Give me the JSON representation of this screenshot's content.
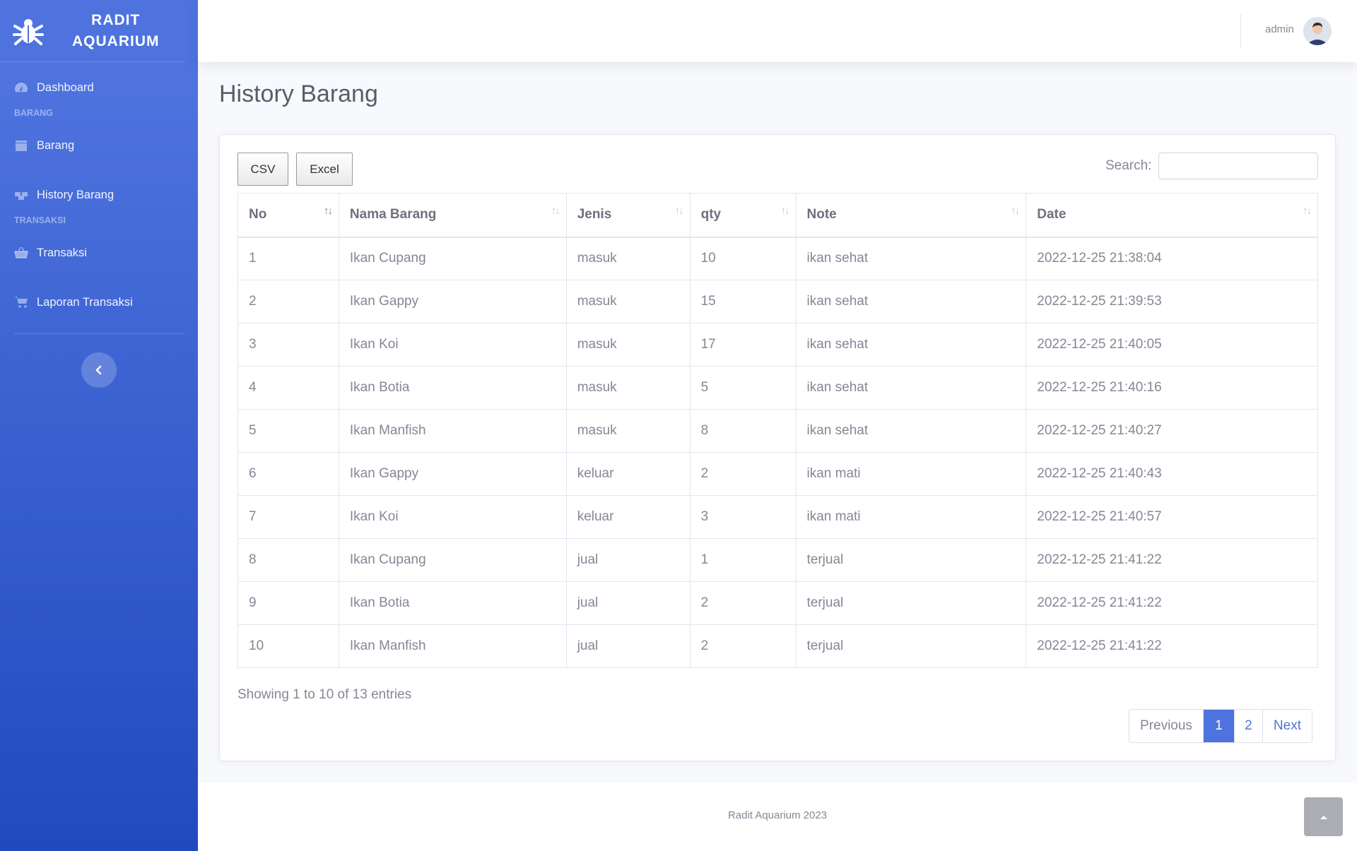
{
  "brand": {
    "line1": "RADIT",
    "line2": "AQUARIUM"
  },
  "sidebar": {
    "dashboard": "Dashboard",
    "heading_barang": "BARANG",
    "barang": "Barang",
    "history_barang": "History Barang",
    "heading_transaksi": "TRANSAKSI",
    "transaksi": "Transaksi",
    "laporan_transaksi": "Laporan Transaksi"
  },
  "topbar": {
    "user_name": "admin"
  },
  "page": {
    "title": "History Barang"
  },
  "toolbar": {
    "csv": "CSV",
    "excel": "Excel",
    "search_label": "Search:",
    "search_value": ""
  },
  "table": {
    "headers": [
      "No",
      "Nama Barang",
      "Jenis",
      "qty",
      "Note",
      "Date"
    ],
    "rows": [
      [
        "1",
        "Ikan Cupang",
        "masuk",
        "10",
        "ikan sehat",
        "2022-12-25 21:38:04"
      ],
      [
        "2",
        "Ikan Gappy",
        "masuk",
        "15",
        "ikan sehat",
        "2022-12-25 21:39:53"
      ],
      [
        "3",
        "Ikan Koi",
        "masuk",
        "17",
        "ikan sehat",
        "2022-12-25 21:40:05"
      ],
      [
        "4",
        "Ikan Botia",
        "masuk",
        "5",
        "ikan sehat",
        "2022-12-25 21:40:16"
      ],
      [
        "5",
        "Ikan Manfish",
        "masuk",
        "8",
        "ikan sehat",
        "2022-12-25 21:40:27"
      ],
      [
        "6",
        "Ikan Gappy",
        "keluar",
        "2",
        "ikan mati",
        "2022-12-25 21:40:43"
      ],
      [
        "7",
        "Ikan Koi",
        "keluar",
        "3",
        "ikan mati",
        "2022-12-25 21:40:57"
      ],
      [
        "8",
        "Ikan Cupang",
        "jual",
        "1",
        "terjual",
        "2022-12-25 21:41:22"
      ],
      [
        "9",
        "Ikan Botia",
        "jual",
        "2",
        "terjual",
        "2022-12-25 21:41:22"
      ],
      [
        "10",
        "Ikan Manfish",
        "jual",
        "2",
        "terjual",
        "2022-12-25 21:41:22"
      ]
    ]
  },
  "table_info": "Showing 1 to 10 of 13 entries",
  "pagination": {
    "previous": "Previous",
    "page1": "1",
    "page2": "2",
    "next": "Next"
  },
  "footer": {
    "text": "Radit Aquarium 2023"
  },
  "colors": {
    "primary": "#4e73df",
    "sidebar_end": "#224abe",
    "text": "#858796"
  }
}
